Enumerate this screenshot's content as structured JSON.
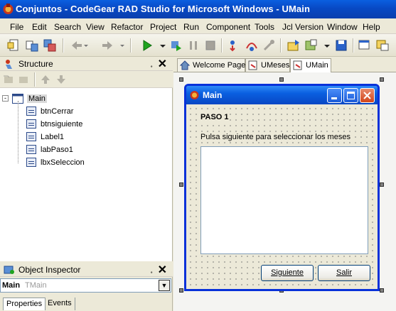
{
  "app": {
    "title": "Conjuntos - CodeGear RAD Studio for Microsoft Windows - UMain"
  },
  "menu": [
    "File",
    "Edit",
    "Search",
    "View",
    "Refactor",
    "Project",
    "Run",
    "Component",
    "Tools",
    "Jcl Version",
    "Window",
    "Help"
  ],
  "toolbar_icons": [
    "new-icon",
    "open-icon",
    "save-all-icon",
    "back-icon",
    "forward-icon",
    "run-icon",
    "run-dropdown-icon",
    "step-icon",
    "pause-icon",
    "stop-icon",
    "trace-into-icon",
    "step-over-icon",
    "run-to-cursor-icon",
    "open-project-icon",
    "add-file-icon",
    "save-icon",
    "view-form-icon",
    "toggle-icon"
  ],
  "structure": {
    "title": "Structure",
    "root": "Main",
    "items": [
      "btnCerrar",
      "btnsiguiente",
      "Label1",
      "labPaso1",
      "lbxSeleccion"
    ]
  },
  "object_inspector": {
    "title": "Object Inspector",
    "selected_name": "Main",
    "selected_type": "TMain",
    "tabs": [
      "Properties",
      "Events"
    ]
  },
  "editor": {
    "tabs": [
      "Welcome Page",
      "UMeses",
      "UMain"
    ],
    "active_tab": "UMain"
  },
  "form": {
    "caption": "Main",
    "step_label": "PASO 1",
    "instruction": "Pulsa siguiente para seleccionar los meses",
    "next_button": "Siguiente",
    "exit_button": "Salir"
  },
  "colors": {
    "titlebar": "#0a5fe0",
    "frame": "#0831d9",
    "close_button": "#d2441a"
  }
}
